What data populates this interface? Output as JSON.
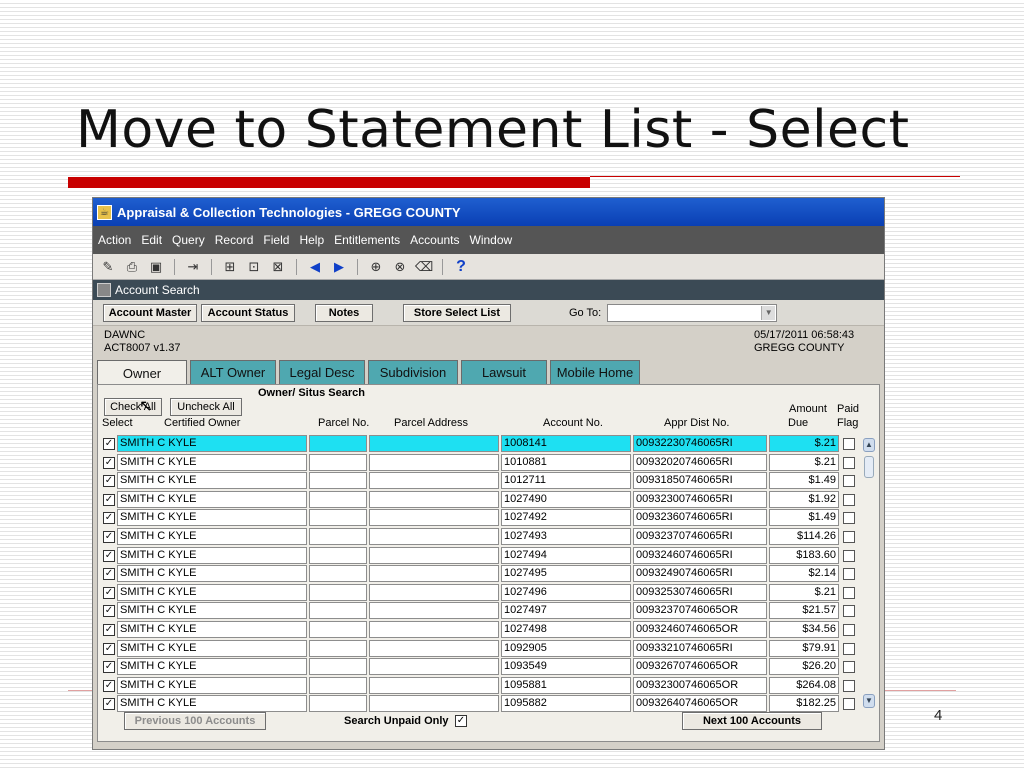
{
  "slide": {
    "title": "Move to Statement List - Select",
    "page_number": "4"
  },
  "app": {
    "window_title": "Appraisal & Collection Technologies - GREGG COUNTY",
    "menu": [
      "Action",
      "Edit",
      "Query",
      "Record",
      "Field",
      "Help",
      "Entitlements",
      "Accounts",
      "Window"
    ],
    "subwindow_title": "Account Search",
    "buttons": {
      "account_master": "Account Master",
      "account_status": "Account Status",
      "notes": "Notes",
      "store_select_list": "Store Select List"
    },
    "goto_label": "Go To:",
    "info": {
      "user": "DAWNC",
      "version": "ACT8007  v1.37",
      "datetime": "05/17/2011 06:58:43",
      "county": "GREGG COUNTY"
    },
    "tabs": [
      "Owner",
      "ALT Owner",
      "Legal Desc",
      "Subdivision",
      "Lawsuit",
      "Mobile Home"
    ],
    "panel_title": "Owner/ Situs Search",
    "check_all": "Check All",
    "uncheck_all": "Uncheck  All",
    "headers": {
      "select": "Select",
      "certified_owner": "Certified Owner",
      "parcel_no": "Parcel No.",
      "parcel_address": "Parcel Address",
      "account_no": "Account No.",
      "appr_dist_no": "Appr Dist No.",
      "amount": "Amount",
      "due": "Due",
      "paid": "Paid",
      "flag": "Flag"
    },
    "rows": [
      {
        "owner": "SMITH C KYLE",
        "parcel": "",
        "address": "",
        "account": "1008141",
        "appr": "00932230746065RI",
        "amount": "$.21"
      },
      {
        "owner": "SMITH C KYLE",
        "parcel": "",
        "address": "",
        "account": "1010881",
        "appr": "00932020746065RI",
        "amount": "$.21"
      },
      {
        "owner": "SMITH C KYLE",
        "parcel": "",
        "address": "",
        "account": "1012711",
        "appr": "00931850746065RI",
        "amount": "$1.49"
      },
      {
        "owner": "SMITH C KYLE",
        "parcel": "",
        "address": "",
        "account": "1027490",
        "appr": "00932300746065RI",
        "amount": "$1.92"
      },
      {
        "owner": "SMITH C KYLE",
        "parcel": "",
        "address": "",
        "account": "1027492",
        "appr": "00932360746065RI",
        "amount": "$1.49"
      },
      {
        "owner": "SMITH C KYLE",
        "parcel": "",
        "address": "",
        "account": "1027493",
        "appr": "00932370746065RI",
        "amount": "$114.26"
      },
      {
        "owner": "SMITH C KYLE",
        "parcel": "",
        "address": "",
        "account": "1027494",
        "appr": "00932460746065RI",
        "amount": "$183.60"
      },
      {
        "owner": "SMITH C KYLE",
        "parcel": "",
        "address": "",
        "account": "1027495",
        "appr": "00932490746065RI",
        "amount": "$2.14"
      },
      {
        "owner": "SMITH C KYLE",
        "parcel": "",
        "address": "",
        "account": "1027496",
        "appr": "00932530746065RI",
        "amount": "$.21"
      },
      {
        "owner": "SMITH C KYLE",
        "parcel": "",
        "address": "",
        "account": "1027497",
        "appr": "00932370746065OR",
        "amount": "$21.57"
      },
      {
        "owner": "SMITH C KYLE",
        "parcel": "",
        "address": "",
        "account": "1027498",
        "appr": "00932460746065OR",
        "amount": "$34.56"
      },
      {
        "owner": "SMITH C KYLE",
        "parcel": "",
        "address": "",
        "account": "1092905",
        "appr": "00933210746065RI",
        "amount": "$79.91"
      },
      {
        "owner": "SMITH C KYLE",
        "parcel": "",
        "address": "",
        "account": "1093549",
        "appr": "00932670746065OR",
        "amount": "$26.20"
      },
      {
        "owner": "SMITH C KYLE",
        "parcel": "",
        "address": "",
        "account": "1095881",
        "appr": "00932300746065OR",
        "amount": "$264.08"
      },
      {
        "owner": "SMITH C KYLE",
        "parcel": "",
        "address": "",
        "account": "1095882",
        "appr": "00932640746065OR",
        "amount": "$182.25"
      }
    ],
    "prev_button": "Previous 100 Accounts",
    "search_unpaid_only": "Search Unpaid Only",
    "next_button": "Next 100 Accounts"
  },
  "colors": {
    "selected_row": "#1ee0f2",
    "tab_teal": "#4fa8b0",
    "title_rule_red": "#c80000",
    "titlebar_blue": "#1f5fd0"
  }
}
